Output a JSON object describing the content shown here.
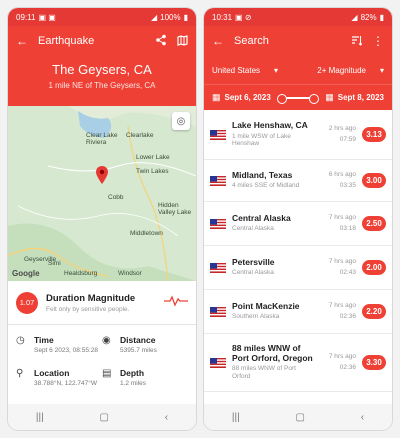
{
  "left": {
    "status": {
      "time": "09:11",
      "battery": "100%"
    },
    "appbar": {
      "title": "Earthquake"
    },
    "hero": {
      "place": "The Geysers, CA",
      "sub": "1 mile NE of The Geysers, CA"
    },
    "map": {
      "labels": [
        "Clear Lake\nRiviera",
        "Clearlake",
        "Lower Lake",
        "Twin Lakes",
        "Cobb",
        "Hidden\nValley Lake",
        "Middletown",
        "Geyserville",
        "Simi",
        "Healdsburg",
        "Windsor"
      ],
      "google": "Google"
    },
    "magnitude": {
      "value": "1.07",
      "title": "Duration Magnitude",
      "sub": "Felt only by sensitive people."
    },
    "details": {
      "time_label": "Time",
      "time_value": "Sept 6 2023, 08:55:28",
      "distance_label": "Distance",
      "distance_value": "5395.7 miles",
      "location_label": "Location",
      "location_value": "38.788°N, 122.747°W",
      "depth_label": "Depth",
      "depth_value": "1.2 miles"
    }
  },
  "right": {
    "status": {
      "time": "10:31",
      "battery": "82%"
    },
    "appbar": {
      "title": "Search"
    },
    "filters": {
      "country": "United States",
      "magnitude": "2+ Magnitude"
    },
    "dates": {
      "start": "Sept 6, 2023",
      "end": "Sept 8, 2023"
    },
    "items": [
      {
        "title": "Lake Henshaw, CA",
        "sub": "1 mile WSW of Lake Henshaw",
        "ago": "2 hrs ago",
        "clock": "07:59",
        "mag": "3.13"
      },
      {
        "title": "Midland, Texas",
        "sub": "4 miles SSE of Midland",
        "ago": "6 hrs ago",
        "clock": "03:35",
        "mag": "3.00"
      },
      {
        "title": "Central Alaska",
        "sub": "Central Alaska",
        "ago": "7 hrs ago",
        "clock": "03:18",
        "mag": "2.50"
      },
      {
        "title": "Petersville",
        "sub": "Central Alaska",
        "ago": "7 hrs ago",
        "clock": "02:43",
        "mag": "2.00"
      },
      {
        "title": "Point MacKenzie",
        "sub": "Southern Alaska",
        "ago": "7 hrs ago",
        "clock": "02:36",
        "mag": "2.20"
      },
      {
        "title": "88 miles WNW of Port Orford, Oregon",
        "sub": "88 miles WNW of Port Orford",
        "ago": "7 hrs ago",
        "clock": "02:36",
        "mag": "3.30"
      }
    ]
  },
  "colors": {
    "accent": "#ef4036",
    "map_green": "#cfe3c9",
    "water": "#a8cfe6"
  },
  "icons": [
    "back-arrow-icon",
    "share-icon",
    "map-icon",
    "my-location-icon",
    "pin-icon",
    "wave-icon",
    "clock-icon",
    "globe-icon",
    "location-pin-icon",
    "depth-icon",
    "filter-icon",
    "more-icon",
    "calendar-icon",
    "us-flag-icon"
  ]
}
